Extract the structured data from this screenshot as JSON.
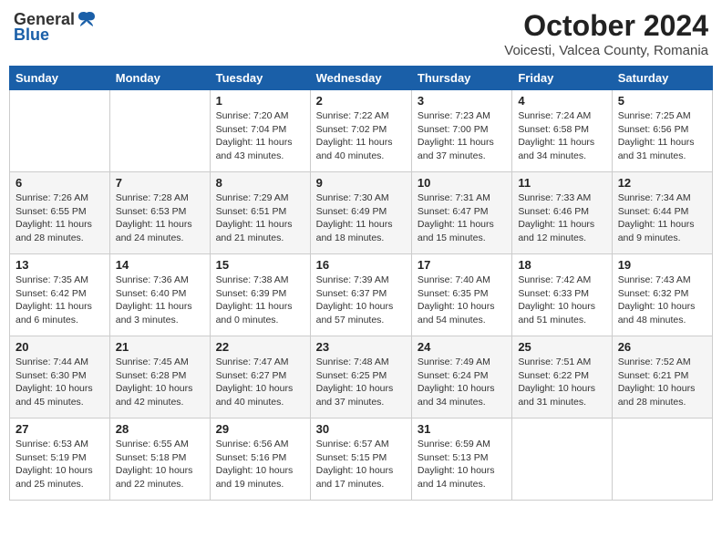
{
  "header": {
    "logo_general": "General",
    "logo_blue": "Blue",
    "month_title": "October 2024",
    "location": "Voicesti, Valcea County, Romania"
  },
  "weekdays": [
    "Sunday",
    "Monday",
    "Tuesday",
    "Wednesday",
    "Thursday",
    "Friday",
    "Saturday"
  ],
  "weeks": [
    [
      {
        "day": "",
        "detail": ""
      },
      {
        "day": "",
        "detail": ""
      },
      {
        "day": "1",
        "detail": "Sunrise: 7:20 AM\nSunset: 7:04 PM\nDaylight: 11 hours and 43 minutes."
      },
      {
        "day": "2",
        "detail": "Sunrise: 7:22 AM\nSunset: 7:02 PM\nDaylight: 11 hours and 40 minutes."
      },
      {
        "day": "3",
        "detail": "Sunrise: 7:23 AM\nSunset: 7:00 PM\nDaylight: 11 hours and 37 minutes."
      },
      {
        "day": "4",
        "detail": "Sunrise: 7:24 AM\nSunset: 6:58 PM\nDaylight: 11 hours and 34 minutes."
      },
      {
        "day": "5",
        "detail": "Sunrise: 7:25 AM\nSunset: 6:56 PM\nDaylight: 11 hours and 31 minutes."
      }
    ],
    [
      {
        "day": "6",
        "detail": "Sunrise: 7:26 AM\nSunset: 6:55 PM\nDaylight: 11 hours and 28 minutes."
      },
      {
        "day": "7",
        "detail": "Sunrise: 7:28 AM\nSunset: 6:53 PM\nDaylight: 11 hours and 24 minutes."
      },
      {
        "day": "8",
        "detail": "Sunrise: 7:29 AM\nSunset: 6:51 PM\nDaylight: 11 hours and 21 minutes."
      },
      {
        "day": "9",
        "detail": "Sunrise: 7:30 AM\nSunset: 6:49 PM\nDaylight: 11 hours and 18 minutes."
      },
      {
        "day": "10",
        "detail": "Sunrise: 7:31 AM\nSunset: 6:47 PM\nDaylight: 11 hours and 15 minutes."
      },
      {
        "day": "11",
        "detail": "Sunrise: 7:33 AM\nSunset: 6:46 PM\nDaylight: 11 hours and 12 minutes."
      },
      {
        "day": "12",
        "detail": "Sunrise: 7:34 AM\nSunset: 6:44 PM\nDaylight: 11 hours and 9 minutes."
      }
    ],
    [
      {
        "day": "13",
        "detail": "Sunrise: 7:35 AM\nSunset: 6:42 PM\nDaylight: 11 hours and 6 minutes."
      },
      {
        "day": "14",
        "detail": "Sunrise: 7:36 AM\nSunset: 6:40 PM\nDaylight: 11 hours and 3 minutes."
      },
      {
        "day": "15",
        "detail": "Sunrise: 7:38 AM\nSunset: 6:39 PM\nDaylight: 11 hours and 0 minutes."
      },
      {
        "day": "16",
        "detail": "Sunrise: 7:39 AM\nSunset: 6:37 PM\nDaylight: 10 hours and 57 minutes."
      },
      {
        "day": "17",
        "detail": "Sunrise: 7:40 AM\nSunset: 6:35 PM\nDaylight: 10 hours and 54 minutes."
      },
      {
        "day": "18",
        "detail": "Sunrise: 7:42 AM\nSunset: 6:33 PM\nDaylight: 10 hours and 51 minutes."
      },
      {
        "day": "19",
        "detail": "Sunrise: 7:43 AM\nSunset: 6:32 PM\nDaylight: 10 hours and 48 minutes."
      }
    ],
    [
      {
        "day": "20",
        "detail": "Sunrise: 7:44 AM\nSunset: 6:30 PM\nDaylight: 10 hours and 45 minutes."
      },
      {
        "day": "21",
        "detail": "Sunrise: 7:45 AM\nSunset: 6:28 PM\nDaylight: 10 hours and 42 minutes."
      },
      {
        "day": "22",
        "detail": "Sunrise: 7:47 AM\nSunset: 6:27 PM\nDaylight: 10 hours and 40 minutes."
      },
      {
        "day": "23",
        "detail": "Sunrise: 7:48 AM\nSunset: 6:25 PM\nDaylight: 10 hours and 37 minutes."
      },
      {
        "day": "24",
        "detail": "Sunrise: 7:49 AM\nSunset: 6:24 PM\nDaylight: 10 hours and 34 minutes."
      },
      {
        "day": "25",
        "detail": "Sunrise: 7:51 AM\nSunset: 6:22 PM\nDaylight: 10 hours and 31 minutes."
      },
      {
        "day": "26",
        "detail": "Sunrise: 7:52 AM\nSunset: 6:21 PM\nDaylight: 10 hours and 28 minutes."
      }
    ],
    [
      {
        "day": "27",
        "detail": "Sunrise: 6:53 AM\nSunset: 5:19 PM\nDaylight: 10 hours and 25 minutes."
      },
      {
        "day": "28",
        "detail": "Sunrise: 6:55 AM\nSunset: 5:18 PM\nDaylight: 10 hours and 22 minutes."
      },
      {
        "day": "29",
        "detail": "Sunrise: 6:56 AM\nSunset: 5:16 PM\nDaylight: 10 hours and 19 minutes."
      },
      {
        "day": "30",
        "detail": "Sunrise: 6:57 AM\nSunset: 5:15 PM\nDaylight: 10 hours and 17 minutes."
      },
      {
        "day": "31",
        "detail": "Sunrise: 6:59 AM\nSunset: 5:13 PM\nDaylight: 10 hours and 14 minutes."
      },
      {
        "day": "",
        "detail": ""
      },
      {
        "day": "",
        "detail": ""
      }
    ]
  ]
}
